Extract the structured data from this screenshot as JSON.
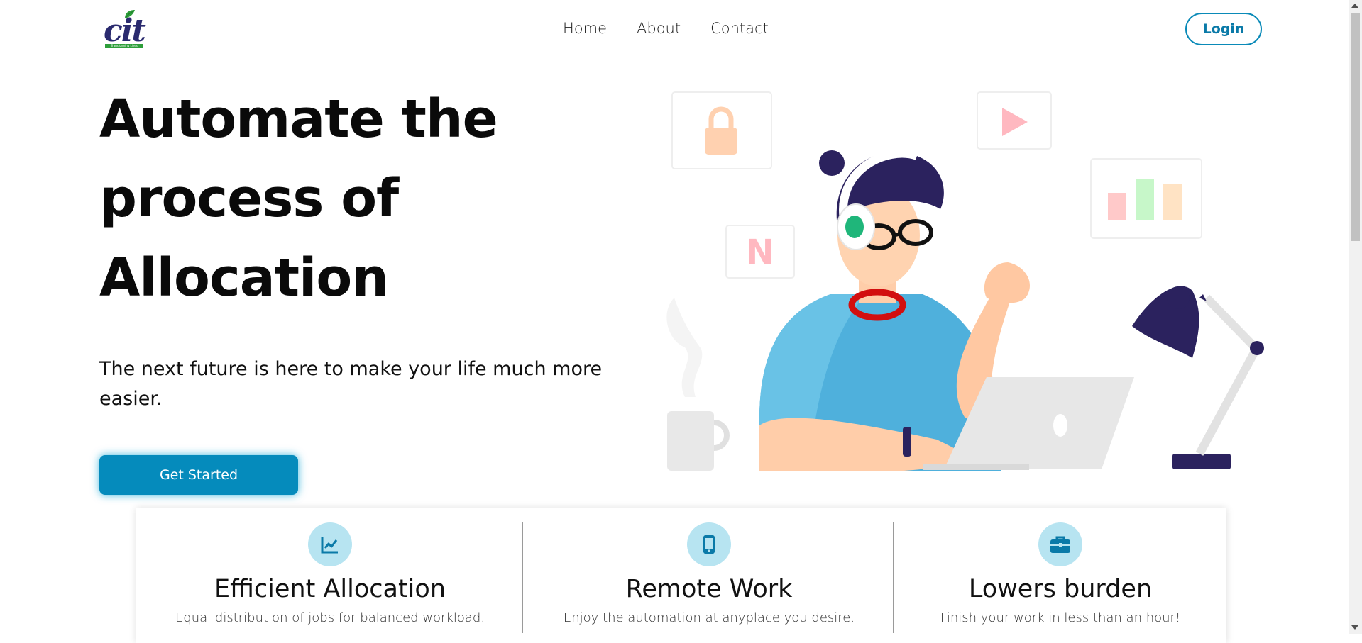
{
  "brand": {
    "logo_text": "cit",
    "logo_tagline": "Transforming Lives",
    "colors": {
      "accent": "#058bbc",
      "logo_navy": "#2a2a6e",
      "logo_green": "#2e9e3a"
    }
  },
  "nav": {
    "links": [
      {
        "label": "Home"
      },
      {
        "label": "About"
      },
      {
        "label": "Contact"
      }
    ],
    "login_label": "Login"
  },
  "hero": {
    "title_lines": [
      "Automate the",
      "process of",
      "Allocation"
    ],
    "subtitle": "The next future is here to make your life much more easier.",
    "cta_label": "Get Started",
    "illustration_letter": "N"
  },
  "features": [
    {
      "icon": "chart-line-icon",
      "title": "Efficient Allocation",
      "description": "Equal distribution of jobs for balanced workload."
    },
    {
      "icon": "mobile-phone-icon",
      "title": "Remote Work",
      "description": "Enjoy the automation at anyplace you desire."
    },
    {
      "icon": "briefcase-icon",
      "title": "Lowers burden",
      "description": "Finish your work in less than an hour!"
    }
  ]
}
